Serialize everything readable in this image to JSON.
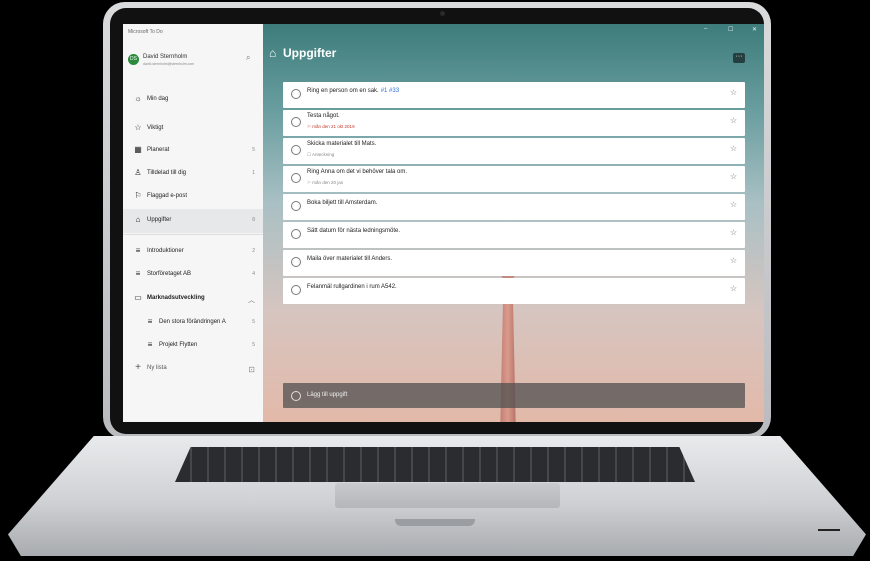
{
  "window": {
    "title": "Microsoft To Do",
    "minimize": "–",
    "maximize": "☐",
    "close": "✕"
  },
  "profile": {
    "initials": "DS",
    "name": "David Sternholm",
    "email": "david.sternholm@sternholm.com",
    "search_icon": "⌕"
  },
  "sidebar": {
    "items": [
      {
        "icon": "☼",
        "label": "Min dag",
        "count": ""
      },
      {
        "icon": "☆",
        "label": "Viktigt",
        "count": ""
      },
      {
        "icon": "▦",
        "label": "Planerat",
        "count": "5"
      },
      {
        "icon": "♙",
        "label": "Tilldelad till dig",
        "count": "1"
      },
      {
        "icon": "⚐",
        "label": "Flaggad e-post",
        "count": ""
      },
      {
        "icon": "⌂",
        "label": "Uppgifter",
        "count": "8"
      }
    ],
    "lists": [
      {
        "icon": "≡",
        "label": "Introduktioner",
        "count": "2"
      },
      {
        "icon": "≡",
        "label": "Storföretaget AB",
        "count": "4"
      }
    ],
    "group": {
      "icon": "▭",
      "label": "Marknadsutveckling",
      "chevron": "︿"
    },
    "group_lists": [
      {
        "icon": "≡",
        "label": "Den stora förändringen A",
        "count": "5"
      },
      {
        "icon": "≡",
        "label": "Projekt Flytten",
        "count": "5"
      }
    ],
    "new_list": {
      "icon": "+",
      "label": "Ny lista",
      "group_icon": "⊡"
    }
  },
  "main": {
    "title_icon": "⌂",
    "title": "Uppgifter",
    "more": "···",
    "tasks": [
      {
        "title": "Ring en person om en sak.",
        "tag": "#1 #33",
        "sub": "",
        "sub_type": ""
      },
      {
        "title": "Testa något.",
        "tag": "",
        "sub": "⚐ mån den 21 okt 2019",
        "sub_type": "red"
      },
      {
        "title": "Skicka materialet till Mats.",
        "tag": "",
        "sub": "☐ Anteckning",
        "sub_type": "gray"
      },
      {
        "title": "Ring Anna om det vi behöver tala om.",
        "tag": "",
        "sub": "⚐ mån den 20 jan",
        "sub_type": "gray"
      },
      {
        "title": "Boka biljett till Amsterdam.",
        "tag": "",
        "sub": "",
        "sub_type": ""
      },
      {
        "title": "Sätt datum för nästa ledningsmöte.",
        "tag": "",
        "sub": "",
        "sub_type": ""
      },
      {
        "title": "Maila över materialet till Anders.",
        "tag": "",
        "sub": "",
        "sub_type": ""
      },
      {
        "title": "Felanmäl rullgardinen i rum A542.",
        "tag": "",
        "sub": "",
        "sub_type": ""
      }
    ],
    "star_icon": "☆",
    "add_task": "Lägg till uppgift"
  }
}
